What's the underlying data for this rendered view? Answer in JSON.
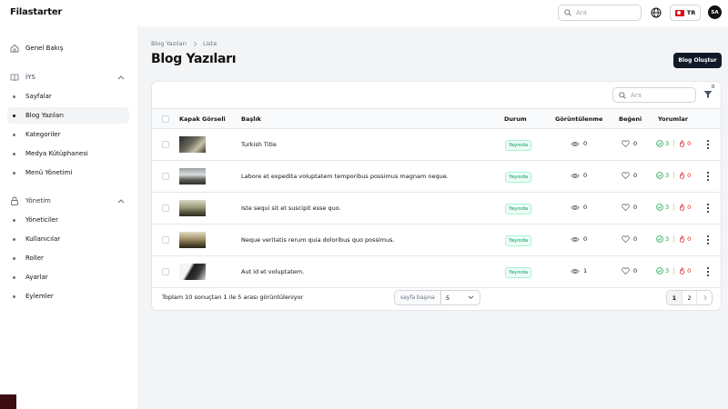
{
  "app": {
    "brand": "Filastarter"
  },
  "header": {
    "search_placeholder": "Ara",
    "language_code": "TR",
    "user_initials": "SA"
  },
  "sidebar": {
    "dashboard": "Genel Bakış",
    "groups": [
      {
        "label": "İYS",
        "items": [
          "Sayfalar",
          "Blog Yazıları",
          "Kategoriler",
          "Medya Kütüphanesi",
          "Menü Yönetimi"
        ]
      },
      {
        "label": "Yönetim",
        "items": [
          "Yöneticiler",
          "Kullanıcılar",
          "Roller",
          "Ayarlar",
          "Eylemler"
        ]
      }
    ],
    "active_item": "Blog Yazıları"
  },
  "breadcrumb": {
    "parent": "Blog Yazıları",
    "current": "Liste"
  },
  "page": {
    "title": "Blog Yazıları",
    "create_button": "Blog Oluştur"
  },
  "table": {
    "search_placeholder": "Ara",
    "filter_count": "0",
    "columns": {
      "cover": "Kapak Görseli",
      "title": "Başlık",
      "status": "Durum",
      "views": "Görüntülenme",
      "likes": "Beğeni",
      "comments": "Yorumlar"
    },
    "rows": [
      {
        "title": "Turkish Title",
        "status": "Yayında",
        "views": "0",
        "likes": "0",
        "approved": "3",
        "rejected": "0"
      },
      {
        "title": "Labore et expedita voluptatem temporibus possimus magnam neque.",
        "status": "Yayında",
        "views": "0",
        "likes": "0",
        "approved": "3",
        "rejected": "0"
      },
      {
        "title": "Iste sequi sit et suscipit esse quo.",
        "status": "Yayında",
        "views": "0",
        "likes": "0",
        "approved": "3",
        "rejected": "0"
      },
      {
        "title": "Neque veritatis rerum quia doloribus quo possimus.",
        "status": "Yayında",
        "views": "0",
        "likes": "0",
        "approved": "3",
        "rejected": "0"
      },
      {
        "title": "Aut id et voluptatem.",
        "status": "Yayında",
        "views": "1",
        "likes": "0",
        "approved": "3",
        "rejected": "0"
      }
    ],
    "footer": {
      "summary": "Toplam 10 sonuçtan 1 ile 5 arası görüntüleniyor",
      "per_page_label": "sayfa başına",
      "per_page_value": "5",
      "pages": [
        "1",
        "2"
      ]
    }
  },
  "colors": {
    "status_green": "#059669",
    "approved_green": "#16a34a",
    "rejected_red": "#dc2626",
    "button_dark": "#111827"
  }
}
